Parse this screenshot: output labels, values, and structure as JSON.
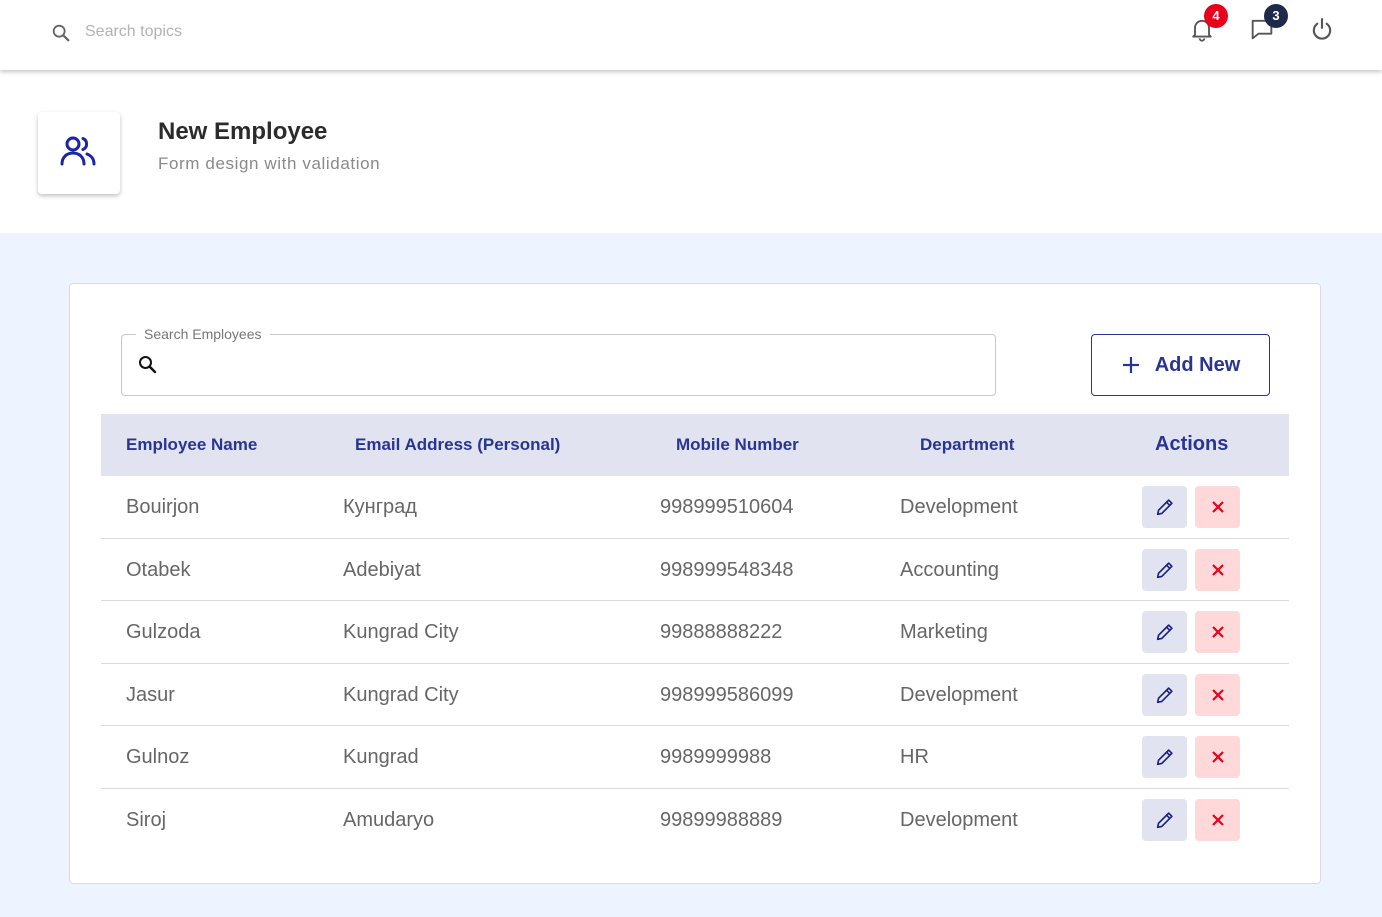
{
  "topbar": {
    "search_placeholder": "Search topics",
    "notifications_count": "4",
    "messages_count": "3",
    "icons": [
      "search-icon",
      "bell-icon",
      "chat-icon",
      "power-icon"
    ]
  },
  "header": {
    "title": "New Employee",
    "subtitle": "Form design with validation",
    "icon": "people-icon"
  },
  "toolbar": {
    "search_label": "Search Employees",
    "search_value": "",
    "add_new_label": "Add New"
  },
  "table": {
    "columns": [
      "Employee Name",
      "Email Address (Personal)",
      "Mobile Number",
      "Department",
      "Actions"
    ],
    "rows": [
      {
        "name": "Bouirjon",
        "email": "Кунград",
        "mobile": "998999510604",
        "department": "Development"
      },
      {
        "name": "Otabek",
        "email": "Adebiyat",
        "mobile": "998999548348",
        "department": "Accounting"
      },
      {
        "name": "Gulzoda",
        "email": "Kungrad City",
        "mobile": "99888888222",
        "department": "Marketing"
      },
      {
        "name": "Jasur",
        "email": "Kungrad City",
        "mobile": "998999586099",
        "department": "Development"
      },
      {
        "name": "Gulnoz",
        "email": "Kungrad",
        "mobile": "9989999988",
        "department": "HR"
      },
      {
        "name": "Siroj",
        "email": "Amudaryo",
        "mobile": "99899988889",
        "department": "Development"
      }
    ]
  },
  "colors": {
    "accent": "#283593",
    "page_bg": "#edf4ff",
    "header_row_bg": "#e1e3f1",
    "delete_bg": "#ffd9d9",
    "delete_icon": "#e8001c",
    "badge_red": "#e8001c",
    "badge_dark": "#1e2a4a"
  }
}
